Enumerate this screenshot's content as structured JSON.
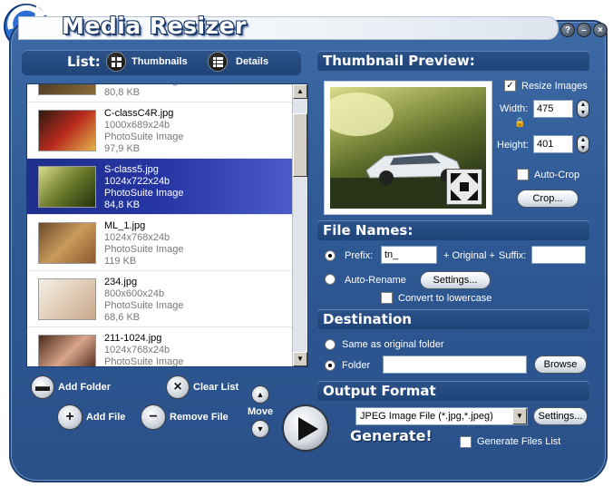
{
  "app": {
    "title": "Media Resizer"
  },
  "window_buttons": {
    "help": "?",
    "minimize": "–",
    "close": "×"
  },
  "list": {
    "label": "List:",
    "views": [
      {
        "label": "Thumbnails"
      },
      {
        "label": "Details"
      }
    ],
    "items": [
      {
        "name": "",
        "dims": "",
        "type": "PhotoSuite Image",
        "size": "80,8 KB",
        "selected": false
      },
      {
        "name": "C-classC4R.jpg",
        "dims": "1000x689x24b",
        "type": "PhotoSuite Image",
        "size": "97,9 KB",
        "selected": false
      },
      {
        "name": "S-class5.jpg",
        "dims": "1024x722x24b",
        "type": "PhotoSuite Image",
        "size": "84,8 KB",
        "selected": true
      },
      {
        "name": "ML_1.jpg",
        "dims": "1024x768x24b",
        "type": "PhotoSuite Image",
        "size": "119 KB",
        "selected": false
      },
      {
        "name": "234.jpg",
        "dims": "800x600x24b",
        "type": "PhotoSuite Image",
        "size": "68,6 KB",
        "selected": false
      },
      {
        "name": "211-1024.jpg",
        "dims": "1024x768x24b",
        "type": "PhotoSuite Image",
        "size": "",
        "selected": false
      }
    ]
  },
  "actions": {
    "add_folder": "Add Folder",
    "add_file": "Add File",
    "clear_list": "Clear List",
    "remove_file": "Remove File",
    "move": "Move",
    "generate": "Generate!"
  },
  "preview": {
    "header": "Thumbnail Preview:",
    "resize_images_label": "Resize Images",
    "resize_images_checked": true,
    "width_label": "Width:",
    "width_value": "475",
    "height_label": "Height:",
    "height_value": "401",
    "auto_crop_label": "Auto-Crop",
    "crop_button": "Crop..."
  },
  "file_names": {
    "header": "File Names:",
    "prefix_label": "Prefix:",
    "prefix_value": "tn_",
    "original_label": "+ Original +",
    "suffix_label": "Suffix:",
    "suffix_value": "",
    "auto_rename_label": "Auto-Rename",
    "settings_button": "Settings...",
    "lowercase_label": "Convert to lowercase"
  },
  "destination": {
    "header": "Destination",
    "same_label": "Same as original folder",
    "folder_label": "Folder",
    "folder_value": "",
    "browse_button": "Browse"
  },
  "output": {
    "header": "Output Format",
    "format_value": "JPEG Image File (*.jpg,*.jpeg)",
    "settings_button": "Settings...",
    "generate_list_label": "Generate Files List"
  }
}
